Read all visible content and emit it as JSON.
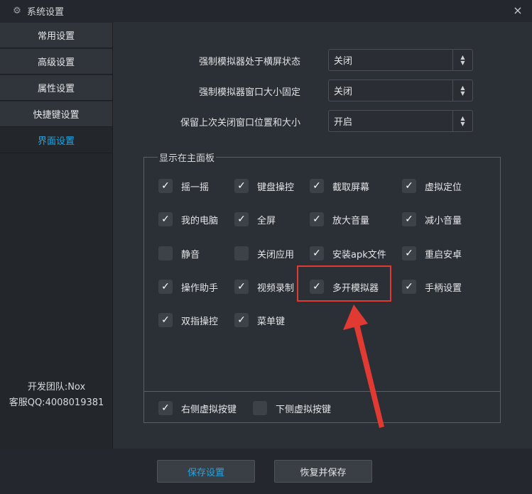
{
  "window": {
    "title": "系统设置",
    "title_icon": "gear-icon",
    "close_glyph": "×"
  },
  "sidebar": {
    "items": [
      {
        "label": "常用设置"
      },
      {
        "label": "高级设置"
      },
      {
        "label": "属性设置"
      },
      {
        "label": "快捷键设置"
      },
      {
        "label": "界面设置",
        "active": true
      }
    ],
    "footer": {
      "team": "开发团队:Nox",
      "qq": "客服QQ:4008019381"
    }
  },
  "settings": [
    {
      "label": "强制模拟器处于横屏状态",
      "value": "关闭"
    },
    {
      "label": "强制模拟器窗口大小固定",
      "value": "关闭"
    },
    {
      "label": "保留上次关闭窗口位置和大小",
      "value": "开启"
    }
  ],
  "panel": {
    "title": "显示在主面板",
    "checkboxes": [
      {
        "label": "摇一摇",
        "checked": true
      },
      {
        "label": "键盘操控",
        "checked": true
      },
      {
        "label": "截取屏幕",
        "checked": true
      },
      {
        "label": "虚拟定位",
        "checked": true
      },
      {
        "label": "我的电脑",
        "checked": true
      },
      {
        "label": "全屏",
        "checked": true
      },
      {
        "label": "放大音量",
        "checked": true
      },
      {
        "label": "减小音量",
        "checked": true
      },
      {
        "label": "静音",
        "checked": false
      },
      {
        "label": "关闭应用",
        "checked": false
      },
      {
        "label": "安装apk文件",
        "checked": true
      },
      {
        "label": "重启安卓",
        "checked": true
      },
      {
        "label": "操作助手",
        "checked": true
      },
      {
        "label": "视频录制",
        "checked": true
      },
      {
        "label": "多开模拟器",
        "checked": true
      },
      {
        "label": "手柄设置",
        "checked": true
      },
      {
        "label": "双指操控",
        "checked": true
      },
      {
        "label": "菜单键",
        "checked": true
      }
    ],
    "bottom_checkboxes": [
      {
        "label": "右侧虚拟按键",
        "checked": true
      },
      {
        "label": "下侧虚拟按键",
        "checked": false
      }
    ]
  },
  "footer": {
    "save_label": "保存设置",
    "restore_label": "恢复并保存"
  },
  "colors": {
    "accent": "#1fa7e6",
    "annotation": "#e03a33"
  }
}
